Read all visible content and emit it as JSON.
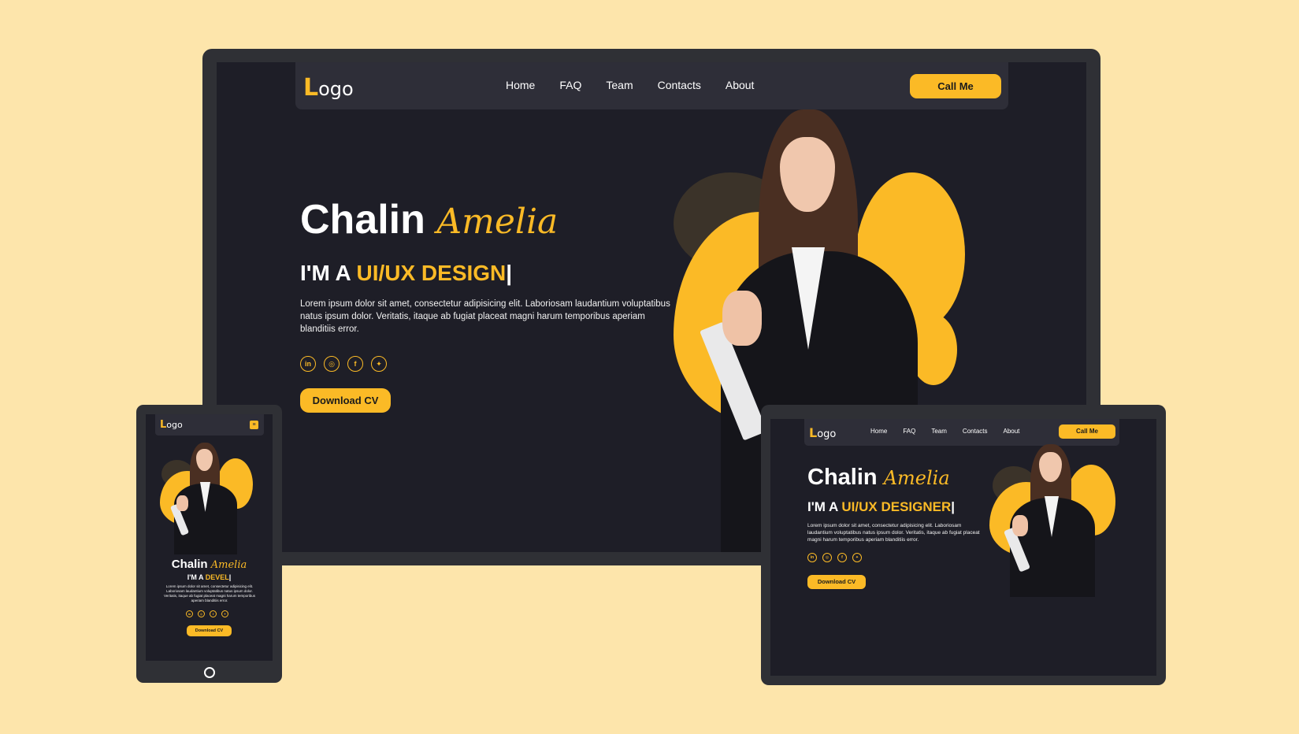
{
  "desktop": {
    "logo_letter": "L",
    "logo_rest": "ogo",
    "nav": [
      "Home",
      "FAQ",
      "Team",
      "Contacts",
      "About"
    ],
    "call_label": "Call Me",
    "first_name": "Chalin",
    "script_name": "Amelia",
    "role_prefix": "I'M A ",
    "role_accent": "UI/UX DESIGN",
    "cursor": "|",
    "text": "Lorem ipsum dolor sit amet, consectetur adipisicing elit. Laboriosam laudantium voluptatibus natus ipsum dolor. Veritatis, itaque ab fugiat placeat magni harum temporibus aperiam blanditiis error.",
    "socials": [
      "linkedin-icon",
      "github-icon",
      "facebook-icon",
      "twitter-icon"
    ],
    "download_label": "Download CV"
  },
  "tablet": {
    "logo_letter": "L",
    "logo_rest": "ogo",
    "nav": [
      "Home",
      "FAQ",
      "Team",
      "Contacts",
      "About"
    ],
    "call_label": "Call Me",
    "first_name": "Chalin",
    "script_name": "Amelia",
    "role_prefix": "I'M A ",
    "role_accent": "UI/UX DESIGNER",
    "cursor": "|",
    "text": "Lorem ipsum dolor sit amet, consectetur adipisicing elit. Laboriosam laudantium voluptatibus natus ipsum dolor. Veritatis, itaque ab fugiat placeat magni harum temporibus aperiam blanditiis error.",
    "download_label": "Download CV"
  },
  "phone": {
    "logo_letter": "L",
    "logo_rest": "ogo",
    "menu_glyph": "≡",
    "first_name": "Chalin",
    "script_name": "Amelia",
    "role_prefix": "I'M A ",
    "role_accent": "DEVEL",
    "cursor": "|",
    "text": "Lorem ipsum dolor sit amet, consectetur adipisicing elit. Laboriosam laudantium voluptatibus natus ipsum dolor. Veritatis, itaque ab fugiat placeat magni harum temporibus aperiam blanditiis error.",
    "download_label": "Download CV"
  },
  "social_glyphs": {
    "linkedin": "in",
    "github": "◎",
    "facebook": "f",
    "twitter": "✦"
  },
  "colors": {
    "background": "#fde5ab",
    "screen": "#1e1e27",
    "accent": "#fbba26",
    "nav": "#2e2e38"
  }
}
